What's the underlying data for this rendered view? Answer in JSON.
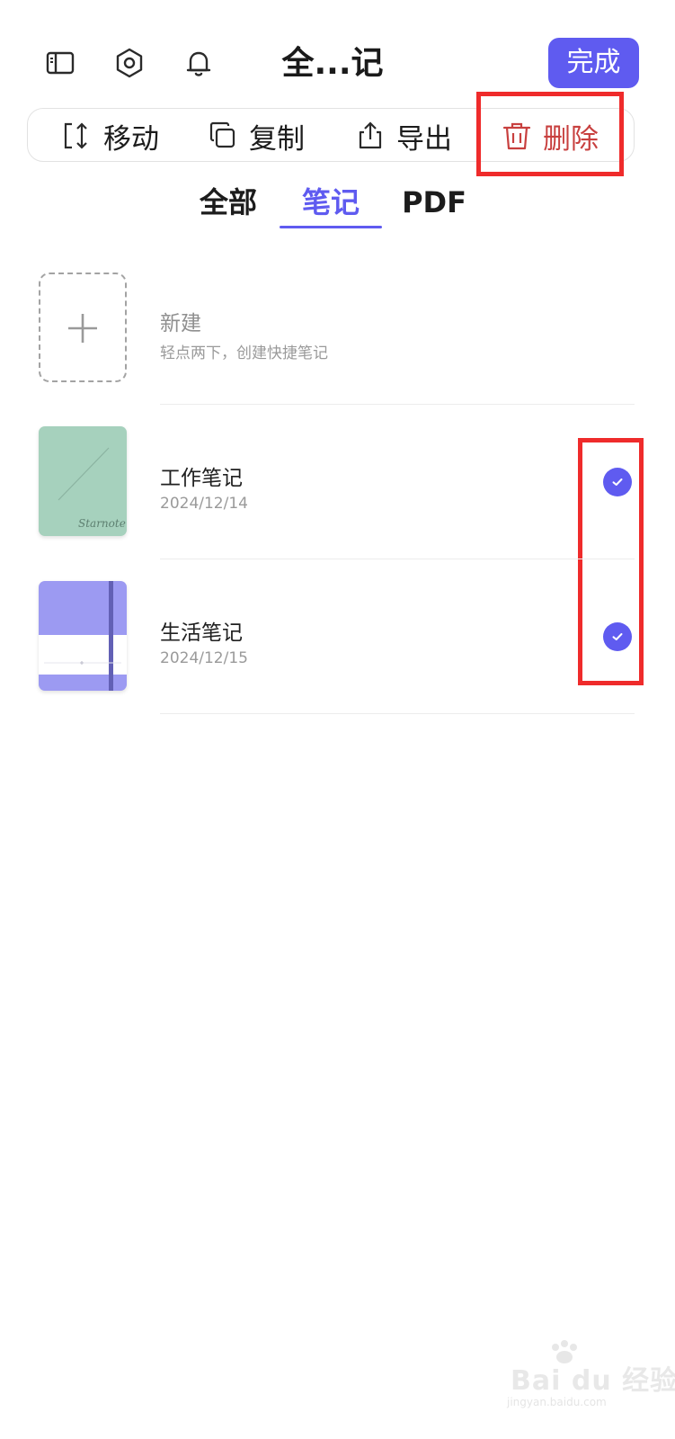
{
  "header": {
    "title": "全...记",
    "done_label": "完成",
    "icons": [
      "sidebar-icon",
      "settings-hex-icon",
      "bell-icon"
    ]
  },
  "toolbar": {
    "move_label": "移动",
    "copy_label": "复制",
    "export_label": "导出",
    "delete_label": "删除",
    "icons": [
      "move-icon",
      "copy-icon",
      "export-icon",
      "trash-icon"
    ]
  },
  "tabs": [
    {
      "label": "全部",
      "active": false
    },
    {
      "label": "笔记",
      "active": true
    },
    {
      "label": "PDF",
      "active": false
    }
  ],
  "new_note": {
    "title": "新建",
    "hint": "轻点两下，创建快捷笔记"
  },
  "notes": [
    {
      "title": "工作笔记",
      "date": "2024/12/14",
      "selected": true,
      "cover_color": "#a6d1bd",
      "cover_script": "Starnote"
    },
    {
      "title": "生活笔记",
      "date": "2024/12/15",
      "selected": true,
      "cover_color": "#9c9af2"
    }
  ],
  "colors": {
    "accent": "#5f5bf0",
    "delete": "#c8403f",
    "highlight": "#ef2b2b"
  },
  "watermark": {
    "main": "Bai du 经验",
    "sub": "jingyan.baidu.com"
  }
}
